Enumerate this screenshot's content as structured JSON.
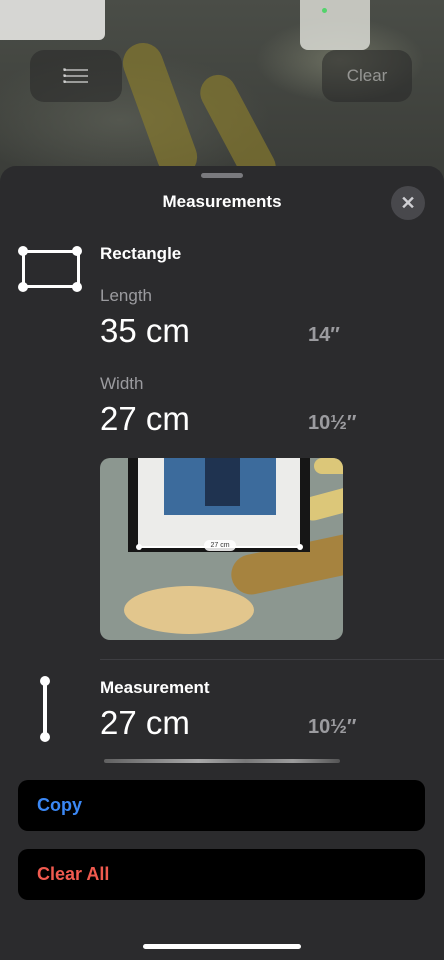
{
  "toolbar": {
    "list_icon": "list-icon",
    "clear_label": "Clear"
  },
  "sheet": {
    "title": "Measurements",
    "close_icon": "close-icon"
  },
  "rectangle": {
    "title": "Rectangle",
    "length_label": "Length",
    "length_cm": "35 cm",
    "length_in": "14″",
    "width_label": "Width",
    "width_cm": "27 cm",
    "width_in": "10½″",
    "photo_measure_label": "27 cm"
  },
  "measurement": {
    "title": "Measurement",
    "value_cm": "27 cm",
    "value_in": "10½″"
  },
  "actions": {
    "copy_label": "Copy",
    "clear_all_label": "Clear All"
  },
  "colors": {
    "sheet_bg": "#2b2b2d",
    "copy_blue": "#3b88f5",
    "clear_red": "#f05a4f"
  }
}
